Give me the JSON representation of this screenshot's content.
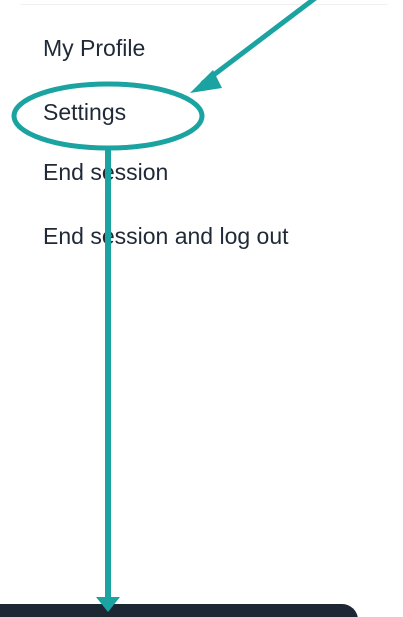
{
  "menu": {
    "items": [
      {
        "label": "My Profile"
      },
      {
        "label": "Settings"
      },
      {
        "label": "End session"
      },
      {
        "label": "End session and log out"
      }
    ]
  },
  "annotation": {
    "color": "#1aa3a0",
    "highlighted_item": "Settings"
  }
}
